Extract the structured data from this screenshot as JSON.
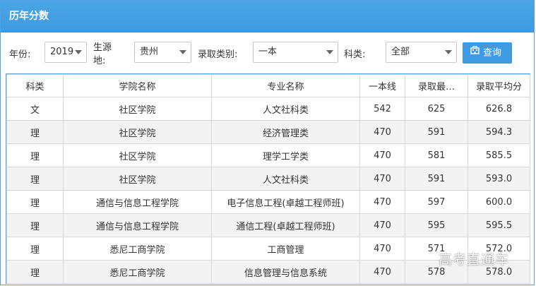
{
  "header": {
    "title": "历年分数"
  },
  "filters": {
    "year_label": "年份:",
    "year_value": "2019",
    "source_label": "生源地:",
    "source_value": "贵州",
    "batch_label": "录取类别:",
    "batch_value": "一本",
    "subject_label": "科类:",
    "subject_value": "全部",
    "query_button": "查询",
    "query_icon": "building-icon"
  },
  "table": {
    "headers": [
      "科类",
      "学院名称",
      "专业名称",
      "一本线",
      "录取最…",
      "录取平均分"
    ],
    "rows": [
      [
        "文",
        "社区学院",
        "人文社科类",
        "542",
        "625",
        "626.8"
      ],
      [
        "理",
        "社区学院",
        "经济管理类",
        "470",
        "591",
        "594.3"
      ],
      [
        "理",
        "社区学院",
        "理学工学类",
        "470",
        "581",
        "585.5"
      ],
      [
        "理",
        "社区学院",
        "人文社科类",
        "470",
        "591",
        "593.0"
      ],
      [
        "理",
        "通信与信息工程学院",
        "电子信息工程(卓越工程师班)",
        "470",
        "597",
        "600.0"
      ],
      [
        "理",
        "通信与信息工程学院",
        "通信工程(卓越工程师班)",
        "470",
        "595",
        "595.5"
      ],
      [
        "理",
        "悉尼工商学院",
        "工商管理",
        "470",
        "571",
        "572.0"
      ],
      [
        "理",
        "悉尼工商学院",
        "信息管理与信息系统",
        "470",
        "578",
        "578.0"
      ]
    ]
  },
  "watermark": "高考直通车",
  "colors": {
    "header_bg": "#4aa6e6",
    "button_bg": "#3e9ae2",
    "border": "#4fa3e0",
    "row_alt": "#f3f3f3"
  }
}
